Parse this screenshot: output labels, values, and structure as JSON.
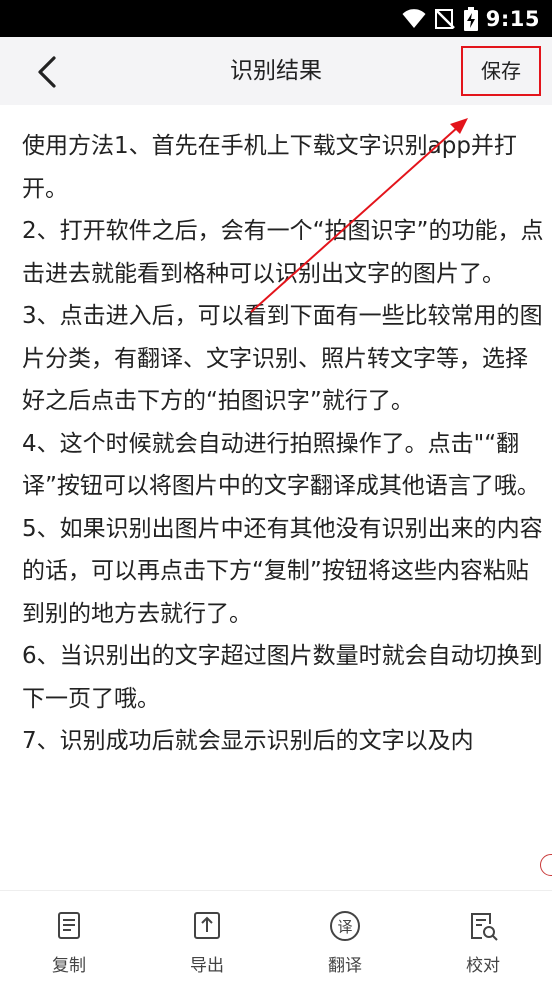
{
  "status_bar": {
    "time": "9:15",
    "icons": [
      "wifi-icon",
      "signal-blocked-icon",
      "battery-charging-icon"
    ]
  },
  "header": {
    "title": "识别结果",
    "back_icon": "chevron-left-icon",
    "save_label": "保存",
    "highlight_color": "#e3141b"
  },
  "content": {
    "paragraphs": [
      "使用方法1、首先在手机上下载文字识别app并打开。",
      "2、打开软件之后，会有一个“拍图识字”的功能，点击进去就能看到格种可以识别出文字的图片了。",
      "3、点击进入后，可以看到下面有一些比较常用的图片分类，有翻译、文字识别、照片转文字等，选择好之后点击下方的“拍图识字”就行了。",
      "4、这个时候就会自动进行拍照操作了。点击\"“翻译”按钮可以将图片中的文字翻译成其他语言了哦。",
      "5、如果识别出图片中还有其他没有识别出来的内容的话，可以再点击下方“复制”按钮将这些内容粘贴到别的地方去就行了。",
      "6、当识别出的文字超过图片数量时就会自动切换到下一页了哦。",
      "7、识别成功后就会显示识别后的文字以及内"
    ]
  },
  "toolbar": {
    "tabs": [
      {
        "label": "复制",
        "icon": "copy-icon"
      },
      {
        "label": "导出",
        "icon": "export-icon"
      },
      {
        "label": "翻译",
        "icon": "translate-icon"
      },
      {
        "label": "校对",
        "icon": "proofread-icon"
      }
    ]
  }
}
